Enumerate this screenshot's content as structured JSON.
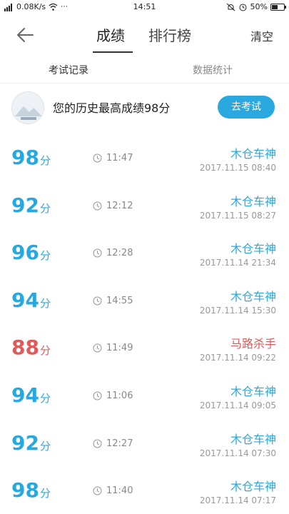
{
  "status_bar": {
    "left_text": "0.08K/s",
    "time": "14:51",
    "battery": "50%",
    "battery_level": 0.5
  },
  "nav": {
    "tab_scores": "成绩",
    "tab_rankings": "排行榜",
    "clear_label": "清空"
  },
  "sub_tabs": {
    "records": "考试记录",
    "stats": "数据统计"
  },
  "best": {
    "text": "您的历史最高成绩98分",
    "button": "去考试"
  },
  "records": [
    {
      "score": "98",
      "unit": "分",
      "duration": "11:47",
      "name": "木仓车神",
      "date": "2017.11.15  08:40",
      "low": false
    },
    {
      "score": "92",
      "unit": "分",
      "duration": "12:12",
      "name": "木仓车神",
      "date": "2017.11.15  08:27",
      "low": false
    },
    {
      "score": "96",
      "unit": "分",
      "duration": "12:28",
      "name": "木仓车神",
      "date": "2017.11.14  21:34",
      "low": false
    },
    {
      "score": "94",
      "unit": "分",
      "duration": "14:55",
      "name": "木仓车神",
      "date": "2017.11.14  15:30",
      "low": false
    },
    {
      "score": "88",
      "unit": "分",
      "duration": "11:49",
      "name": "马路杀手",
      "date": "2017.11.14  09:22",
      "low": true
    },
    {
      "score": "94",
      "unit": "分",
      "duration": "11:06",
      "name": "木仓车神",
      "date": "2017.11.14  09:05",
      "low": false
    },
    {
      "score": "92",
      "unit": "分",
      "duration": "12:27",
      "name": "木仓车神",
      "date": "2017.11.14  07:30",
      "low": false
    },
    {
      "score": "98",
      "unit": "分",
      "duration": "11:40",
      "name": "木仓车神",
      "date": "2017.11.14  07:17",
      "low": false
    }
  ]
}
